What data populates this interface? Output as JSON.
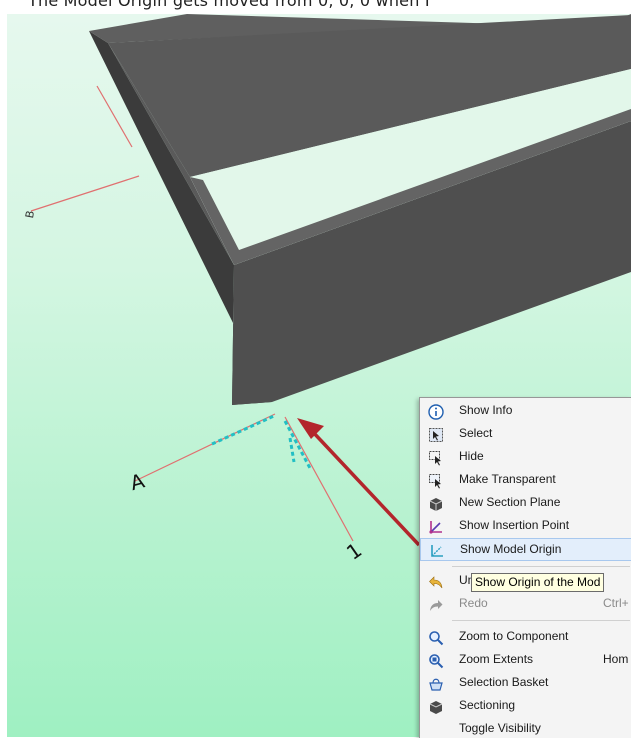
{
  "caption": {
    "text": "The Model Origin gets moved from 0, 0, 0 when I"
  },
  "viewport": {
    "axis_labels": {
      "a": "A",
      "b": "B",
      "one": "1"
    }
  },
  "context_menu": {
    "items": [
      {
        "label": "Show Info",
        "icon": "info-icon",
        "shortcut": ""
      },
      {
        "label": "Select",
        "icon": "select-icon",
        "shortcut": ""
      },
      {
        "label": "Hide",
        "icon": "hide-icon",
        "shortcut": ""
      },
      {
        "label": "Make Transparent",
        "icon": "transparent-icon",
        "shortcut": ""
      },
      {
        "label": "New Section Plane",
        "icon": "section-plane-icon",
        "shortcut": ""
      },
      {
        "label": "Show Insertion Point",
        "icon": "insertion-point-icon",
        "shortcut": ""
      },
      {
        "label": "Show Model Origin",
        "icon": "model-origin-icon",
        "shortcut": ""
      },
      {
        "label": "Undo S",
        "icon": "undo-icon",
        "shortcut": ""
      },
      {
        "label": "Redo",
        "icon": "redo-icon",
        "shortcut": "Ctrl+"
      },
      {
        "label": "Zoom to Component",
        "icon": "zoom-component-icon",
        "shortcut": ""
      },
      {
        "label": "Zoom Extents",
        "icon": "zoom-extents-icon",
        "shortcut": "Hom"
      },
      {
        "label": "Selection Basket",
        "icon": "selection-basket-icon",
        "shortcut": ""
      },
      {
        "label": "Sectioning",
        "icon": "sectioning-icon",
        "shortcut": ""
      },
      {
        "label": "Toggle Visibility",
        "icon": "",
        "shortcut": ""
      }
    ]
  },
  "tooltip": {
    "text": "Show Origin of the Mod"
  },
  "colors": {
    "background_top": "#e6f8ee",
    "background_bottom": "#9ff0c2",
    "box_top": "#5e5e5e",
    "box_front": "#505050",
    "box_side": "#3a3a3a",
    "axis_line": "#e07070",
    "origin_marker": "#22bfc4",
    "arrow": "#b3262c",
    "menu_highlight": "#e3eefb",
    "tooltip_bg": "#ffffe1"
  }
}
